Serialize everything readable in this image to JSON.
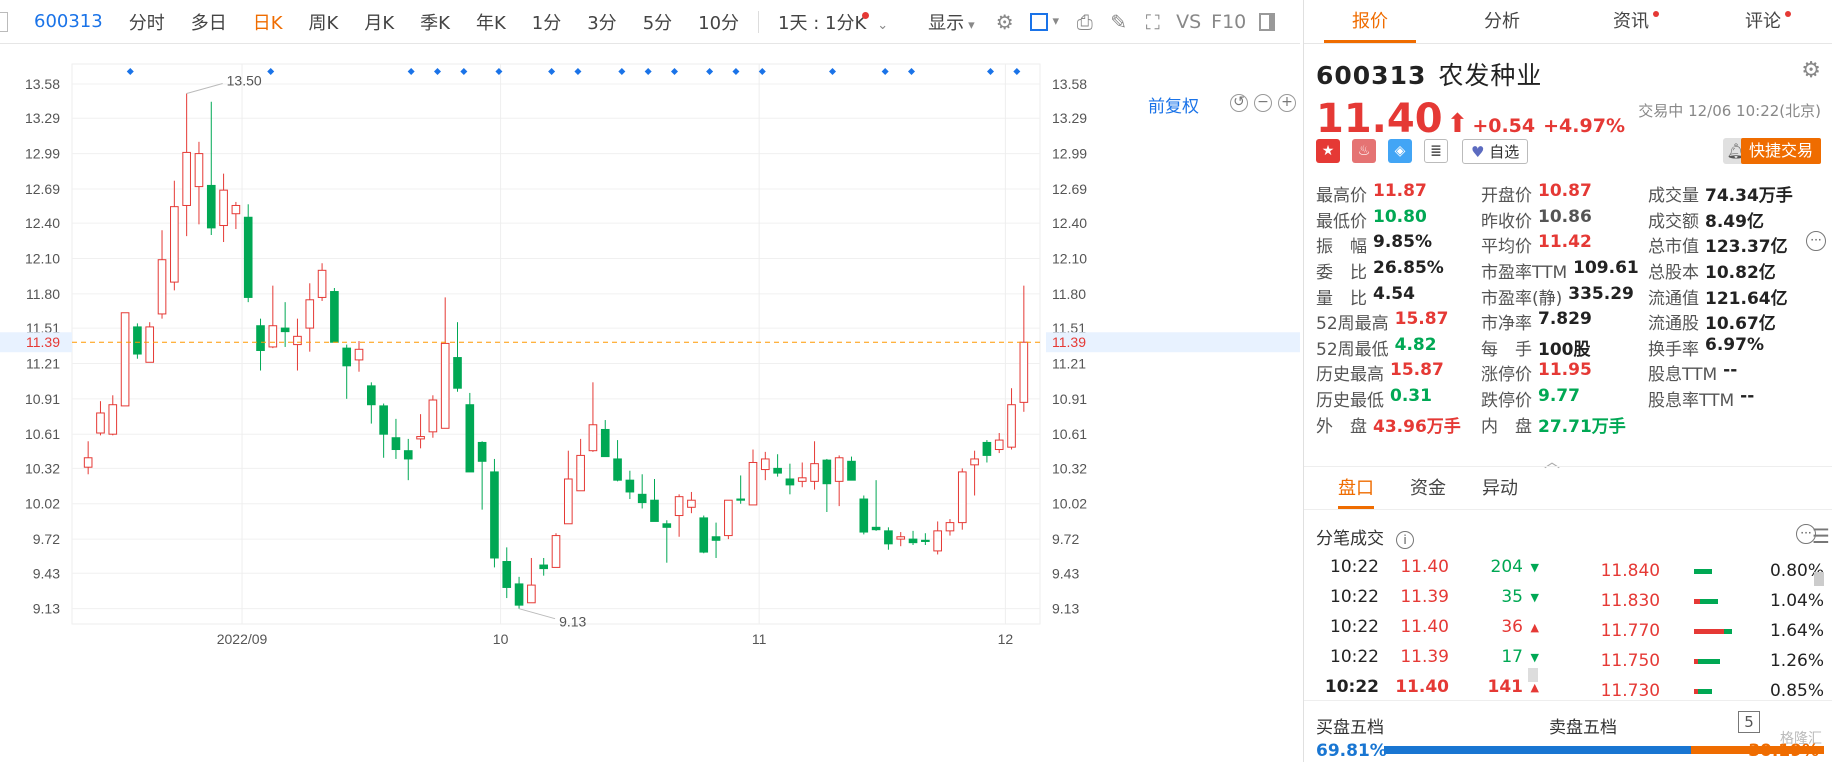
{
  "toolbar": {
    "code": "600313",
    "periods": [
      "分时",
      "多日",
      "日K",
      "周K",
      "月K",
      "季K",
      "年K",
      "1分",
      "3分",
      "5分",
      "10分"
    ],
    "active_period": "日K",
    "interval": "1天 : 1分K",
    "display": "显示",
    "vs": "VS",
    "f10": "F10"
  },
  "chart": {
    "restore_label": "前复权",
    "current_price_label": "11.39",
    "high_label": "13.50",
    "low_label": "9.13",
    "colors": {
      "up": "#e53935",
      "down": "#00a854",
      "price_line": "#ff9800",
      "marker": "#1a73e8"
    }
  },
  "chart_data": {
    "type": "candlestick",
    "yticks": [
      "13.58",
      "13.29",
      "12.99",
      "12.69",
      "12.40",
      "12.10",
      "11.80",
      "11.51",
      "11.21",
      "10.91",
      "10.61",
      "10.32",
      "10.02",
      "9.72",
      "9.43",
      "9.13"
    ],
    "xlabels": [
      "2022/09",
      "10",
      "11",
      "12"
    ],
    "ylim": [
      9.0,
      13.75
    ],
    "current_price": 11.39,
    "marked_high": 13.5,
    "marked_low": 9.13,
    "candles": [
      [
        10.33,
        10.41,
        10.55,
        10.27
      ],
      [
        10.62,
        10.79,
        10.89,
        10.6
      ],
      [
        10.61,
        10.86,
        10.94,
        10.6
      ],
      [
        10.85,
        11.64,
        11.64,
        10.85
      ],
      [
        11.52,
        11.29,
        11.55,
        11.25
      ],
      [
        11.22,
        11.52,
        11.56,
        11.22
      ],
      [
        11.63,
        12.09,
        12.34,
        11.59
      ],
      [
        11.9,
        12.54,
        12.76,
        11.83
      ],
      [
        12.55,
        13.0,
        13.5,
        12.29
      ],
      [
        12.71,
        12.99,
        13.09,
        12.39
      ],
      [
        12.72,
        12.36,
        13.43,
        12.3
      ],
      [
        12.38,
        12.68,
        12.82,
        12.24
      ],
      [
        12.48,
        12.55,
        12.58,
        12.35
      ],
      [
        12.45,
        11.77,
        12.56,
        11.73
      ],
      [
        11.53,
        11.32,
        11.59,
        11.15
      ],
      [
        11.35,
        11.53,
        11.87,
        11.34
      ],
      [
        11.51,
        11.48,
        11.73,
        11.35
      ],
      [
        11.37,
        11.44,
        11.59,
        11.15
      ],
      [
        11.51,
        11.75,
        11.89,
        11.31
      ],
      [
        11.77,
        12.0,
        12.06,
        11.74
      ],
      [
        11.82,
        11.39,
        11.85,
        11.39
      ],
      [
        11.34,
        11.19,
        11.37,
        10.91
      ],
      [
        11.24,
        11.33,
        11.4,
        11.14
      ],
      [
        11.02,
        10.86,
        11.05,
        10.7
      ],
      [
        10.85,
        10.61,
        10.87,
        10.41
      ],
      [
        10.58,
        10.48,
        10.74,
        10.4
      ],
      [
        10.47,
        10.4,
        10.57,
        10.22
      ],
      [
        10.57,
        10.59,
        10.78,
        10.49
      ],
      [
        10.63,
        10.9,
        10.94,
        10.58
      ],
      [
        10.66,
        11.38,
        11.77,
        10.66
      ],
      [
        11.26,
        11.0,
        11.56,
        10.97
      ],
      [
        10.86,
        10.29,
        10.96,
        10.29
      ],
      [
        10.54,
        10.38,
        10.55,
        9.97
      ],
      [
        10.29,
        9.56,
        10.4,
        9.48
      ],
      [
        9.53,
        9.31,
        9.65,
        9.22
      ],
      [
        9.34,
        9.16,
        9.4,
        9.13
      ],
      [
        9.18,
        9.33,
        9.56,
        9.18
      ],
      [
        9.5,
        9.47,
        9.56,
        9.41
      ],
      [
        9.48,
        9.75,
        9.77,
        9.5
      ],
      [
        9.85,
        10.23,
        10.47,
        9.85
      ],
      [
        10.13,
        10.43,
        10.57,
        10.13
      ],
      [
        10.47,
        10.69,
        11.05,
        10.46
      ],
      [
        10.65,
        10.42,
        10.73,
        10.42
      ],
      [
        10.4,
        10.22,
        10.56,
        10.21
      ],
      [
        10.22,
        10.12,
        10.3,
        10.06
      ],
      [
        10.1,
        10.03,
        10.27,
        9.98
      ],
      [
        10.05,
        9.87,
        10.23,
        9.87
      ],
      [
        9.85,
        9.82,
        9.88,
        9.52
      ],
      [
        9.92,
        10.08,
        10.1,
        9.74
      ],
      [
        9.99,
        10.05,
        10.12,
        9.94
      ],
      [
        9.9,
        9.61,
        9.92,
        9.6
      ],
      [
        9.74,
        9.71,
        9.86,
        9.56
      ],
      [
        9.75,
        10.05,
        10.05,
        9.72
      ],
      [
        10.06,
        10.05,
        10.26,
        10.02
      ],
      [
        10.01,
        10.37,
        10.48,
        10.01
      ],
      [
        10.31,
        10.4,
        10.46,
        10.22
      ],
      [
        10.32,
        10.28,
        10.44,
        10.25
      ],
      [
        10.23,
        10.18,
        10.36,
        10.1
      ],
      [
        10.21,
        10.24,
        10.37,
        10.16
      ],
      [
        10.21,
        10.36,
        10.55,
        10.14
      ],
      [
        10.39,
        10.19,
        10.4,
        9.95
      ],
      [
        10.21,
        10.41,
        10.43,
        10.0
      ],
      [
        10.38,
        10.22,
        10.42,
        10.22
      ],
      [
        10.06,
        9.78,
        10.09,
        9.76
      ],
      [
        9.82,
        9.8,
        10.22,
        9.79
      ],
      [
        9.79,
        9.68,
        9.82,
        9.63
      ],
      [
        9.72,
        9.74,
        9.78,
        9.66
      ],
      [
        9.72,
        9.69,
        9.79,
        9.67
      ],
      [
        9.71,
        9.7,
        9.77,
        9.67
      ],
      [
        9.62,
        9.79,
        9.87,
        9.59
      ],
      [
        9.79,
        9.86,
        9.89,
        9.75
      ],
      [
        9.86,
        10.29,
        10.32,
        9.8
      ],
      [
        10.35,
        10.4,
        10.47,
        10.09
      ],
      [
        10.54,
        10.43,
        10.56,
        10.37
      ],
      [
        10.48,
        10.56,
        10.62,
        10.45
      ],
      [
        10.5,
        10.86,
        11.0,
        10.48
      ],
      [
        10.88,
        11.39,
        11.87,
        10.8
      ]
    ],
    "markers": [
      5,
      21,
      37,
      40,
      43,
      47,
      53,
      56,
      61,
      64,
      67,
      71,
      74,
      77,
      85,
      91,
      94,
      103,
      106
    ]
  },
  "stock": {
    "code": "600313",
    "name": "农发种业",
    "price": "11.40",
    "change": "+0.54",
    "change_pct": "+4.97%",
    "status": "交易中 12/06 10:22(北京)",
    "fav_label": "自选",
    "quick_trade": "快捷交易"
  },
  "right_tabs": [
    "报价",
    "分析",
    "资讯",
    "评论"
  ],
  "stats": [
    [
      [
        "最高价",
        "11.87",
        "up"
      ],
      [
        "开盘价",
        "10.87",
        "up"
      ],
      [
        "成交量",
        "74.34万手",
        ""
      ]
    ],
    [
      [
        "最低价",
        "10.80",
        "dn"
      ],
      [
        "昨收价",
        "10.86",
        "gray"
      ],
      [
        "成交额",
        "8.49亿",
        ""
      ]
    ],
    [
      [
        "振　幅",
        "9.85%",
        ""
      ],
      [
        "平均价",
        "11.42",
        "up"
      ],
      [
        "总市值",
        "123.37亿",
        ""
      ]
    ],
    [
      [
        "委　比",
        "26.85%",
        ""
      ],
      [
        "市盈率TTM",
        "109.61",
        ""
      ],
      [
        "总股本",
        "10.82亿",
        ""
      ]
    ],
    [
      [
        "量　比",
        "4.54",
        ""
      ],
      [
        "市盈率(静)",
        "335.29",
        ""
      ],
      [
        "流通值",
        "121.64亿",
        ""
      ]
    ],
    [
      [
        "52周最高",
        "15.87",
        "up"
      ],
      [
        "市净率",
        "7.829",
        ""
      ],
      [
        "流通股",
        "10.67亿",
        ""
      ]
    ],
    [
      [
        "52周最低",
        "4.82",
        "dn"
      ],
      [
        "每　手",
        "100股",
        ""
      ],
      [
        "换手率",
        "6.97%",
        ""
      ]
    ],
    [
      [
        "历史最高",
        "15.87",
        "up"
      ],
      [
        "涨停价",
        "11.95",
        "up"
      ],
      [
        "股息TTM",
        "--",
        ""
      ]
    ],
    [
      [
        "历史最低",
        "0.31",
        "dn"
      ],
      [
        "跌停价",
        "9.77",
        "dn"
      ],
      [
        "股息率TTM",
        "--",
        ""
      ]
    ],
    [
      [
        "外　盘",
        "43.96万手",
        "up"
      ],
      [
        "内　盘",
        "27.71万手",
        "dn"
      ],
      [
        "",
        "",
        ""
      ]
    ]
  ],
  "sub_tabs": [
    "盘口",
    "资金",
    "异动"
  ],
  "ticks_title": "分笔成交",
  "ticks": [
    {
      "time": "10:22",
      "price": "11.40",
      "vol": "204",
      "dir": "dn"
    },
    {
      "time": "10:22",
      "price": "11.39",
      "vol": "35",
      "dir": "dn"
    },
    {
      "time": "10:22",
      "price": "11.40",
      "vol": "36",
      "dir": "up"
    },
    {
      "time": "10:22",
      "price": "11.39",
      "vol": "17",
      "dir": "dn"
    },
    {
      "time": "10:22",
      "price": "11.40",
      "vol": "141",
      "dir": "up"
    }
  ],
  "distribution": [
    {
      "price": "11.840",
      "pct": "0.80%",
      "red": 0,
      "green": 18
    },
    {
      "price": "11.830",
      "pct": "1.04%",
      "red": 6,
      "green": 18
    },
    {
      "price": "11.770",
      "pct": "1.64%",
      "red": 30,
      "green": 8
    },
    {
      "price": "11.750",
      "pct": "1.26%",
      "red": 4,
      "green": 22
    },
    {
      "price": "11.730",
      "pct": "0.85%",
      "red": 4,
      "green": 14
    }
  ],
  "five": {
    "buy_label": "买盘五档",
    "sell_label": "卖盘五档",
    "count": "5",
    "buy_pct": "69.81%",
    "sell_pct": "30.19%"
  },
  "watermark": "格隆汇"
}
